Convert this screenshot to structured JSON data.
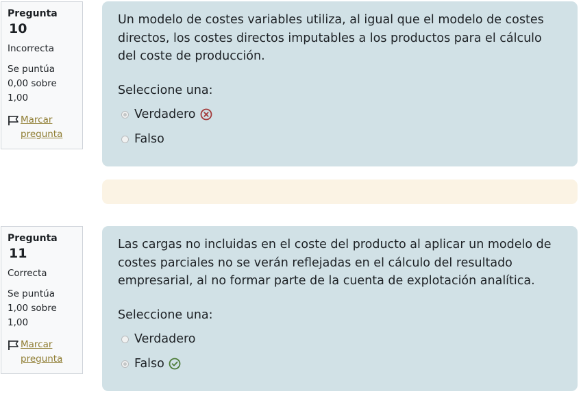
{
  "questions": [
    {
      "title_prefix": "Pregunta",
      "number": "10",
      "state": "Incorrecta",
      "grade": "Se puntúa 0,00 sobre 1,00",
      "flag_label": "Marcar pregunta",
      "text": "Un modelo de costes variables utiliza, al igual que el modelo de costes directos, los costes directos imputables a los productos para el cálculo del coste de producción.",
      "prompt": "Seleccione una:",
      "options": [
        {
          "label": "Verdadero",
          "selected": true,
          "feedback": "incorrect-icon"
        },
        {
          "label": "Falso",
          "selected": false,
          "feedback": ""
        }
      ]
    },
    {
      "title_prefix": "Pregunta",
      "number": "11",
      "state": "Correcta",
      "grade": "Se puntúa 1,00 sobre 1,00",
      "flag_label": "Marcar pregunta",
      "text": "Las cargas no incluidas en el coste del producto al aplicar un modelo de costes parciales no se verán reflejadas en el cálculo del resultado empresarial, al no formar parte de la cuenta de explotación analítica.",
      "prompt": "Seleccione una:",
      "options": [
        {
          "label": "Verdadero",
          "selected": false,
          "feedback": ""
        },
        {
          "label": "Falso",
          "selected": true,
          "feedback": "correct-icon"
        }
      ]
    }
  ],
  "colors": {
    "content_bg": "#d1e1e6",
    "feedback_bg": "#fbf3e4",
    "info_bg": "#f8f9fa",
    "link": "#8f7d32",
    "incorrect": "#a33a3a",
    "correct": "#4e7d3a"
  }
}
